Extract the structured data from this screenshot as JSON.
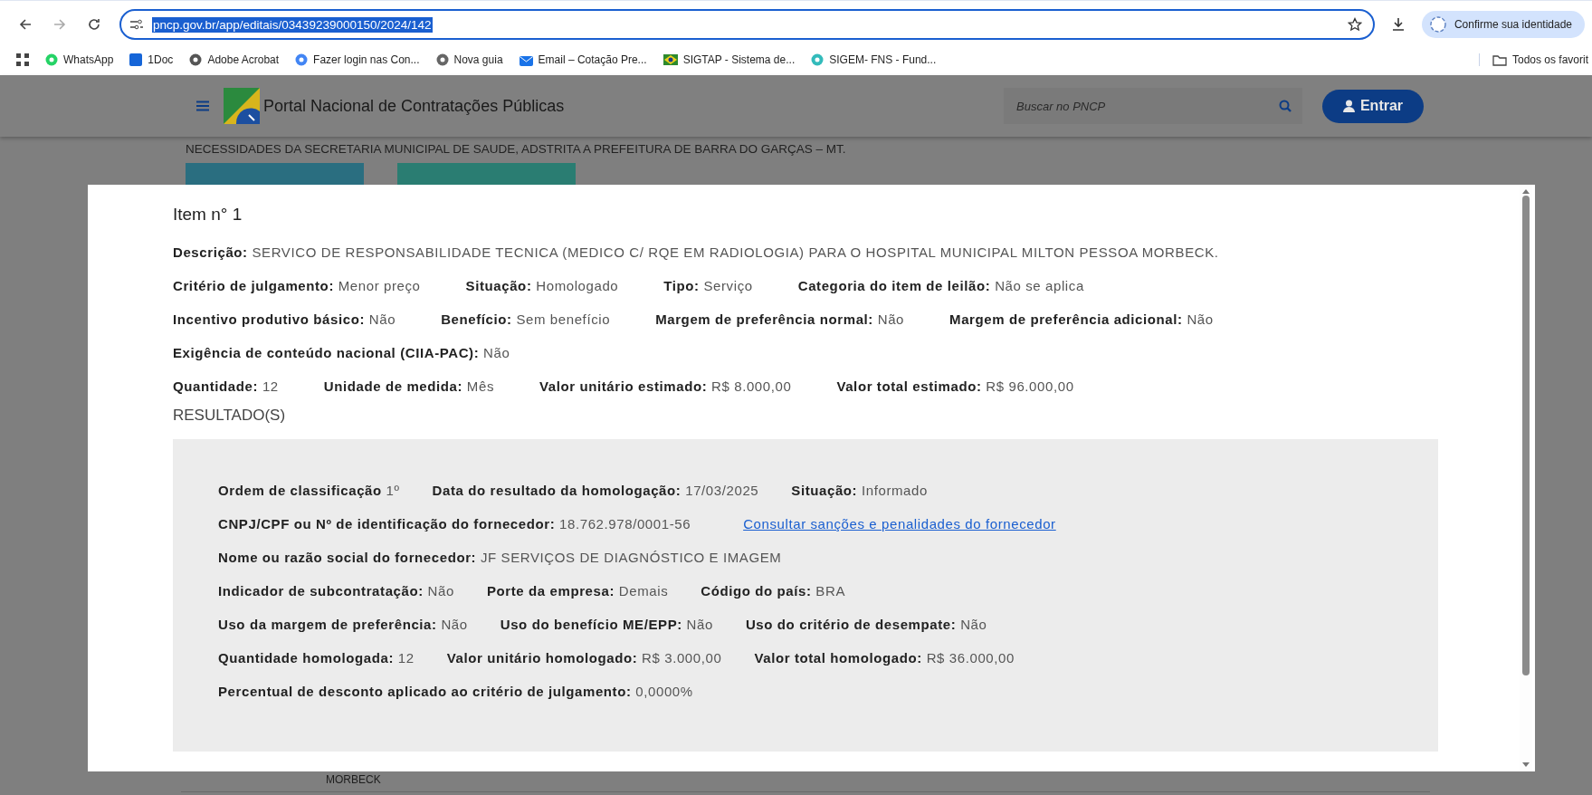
{
  "browser": {
    "address": {
      "text": "pncp.gov.br/app/editais/03439239000150/2024/142",
      "selected": true
    },
    "identity_button": "Confirme sua identidade",
    "bookmarks": [
      {
        "label": "WhatsApp"
      },
      {
        "label": "1Doc"
      },
      {
        "label": "Adobe Acrobat"
      },
      {
        "label": "Fazer login nas Con..."
      },
      {
        "label": "Nova guia"
      },
      {
        "label": "Email – Cotação Pre..."
      },
      {
        "label": "SIGTAP - Sistema de..."
      },
      {
        "label": "SIGEM- FNS - Fund..."
      }
    ],
    "all_bookmarks": "Todos os favorit"
  },
  "page": {
    "header": {
      "title": "Portal Nacional de Contratações Públicas",
      "search_placeholder": "Buscar no PNCP",
      "login_button": "Entrar"
    },
    "object_text": "NECESSIDADES DA SECRETARIA MUNICIPAL DE SAUDE, ADSTRITA A PREFEITURA DE BARRA DO GARÇAS – MT.",
    "below_text": "MORBECK"
  },
  "modal": {
    "title": "Item n° 1",
    "rows": [
      [
        {
          "label": "Descrição:",
          "value": "SERVICO DE RESPONSABILIDADE TECNICA (MEDICO C/ RQE EM RADIOLOGIA) PARA O HOSPITAL MUNICIPAL MILTON PESSOA MORBECK."
        }
      ],
      [
        {
          "label": "Critério de julgamento:",
          "value": "Menor preço"
        },
        {
          "label": "Situação:",
          "value": "Homologado"
        },
        {
          "label": "Tipo:",
          "value": "Serviço"
        },
        {
          "label": "Categoria do item de leilão:",
          "value": "Não se aplica"
        }
      ],
      [
        {
          "label": "Incentivo produtivo básico:",
          "value": "Não"
        },
        {
          "label": "Benefício:",
          "value": "Sem benefício"
        },
        {
          "label": "Margem de preferência normal:",
          "value": "Não"
        },
        {
          "label": "Margem de preferência adicional:",
          "value": "Não"
        }
      ],
      [
        {
          "label": "Exigência de conteúdo nacional (CIIA-PAC):",
          "value": "Não"
        }
      ],
      [
        {
          "label": "Quantidade:",
          "value": "12"
        },
        {
          "label": "Unidade de medida:",
          "value": "Mês"
        },
        {
          "label": "Valor unitário estimado:",
          "value": "R$ 8.000,00"
        },
        {
          "label": "Valor total estimado:",
          "value": "R$ 96.000,00"
        }
      ]
    ],
    "results_heading": "RESULTADO(S)",
    "result_rows": [
      [
        {
          "kind": "field",
          "label": "Ordem de classificação",
          "value": "1º"
        },
        {
          "kind": "field",
          "label": "Data do resultado da homologação:",
          "value": "17/03/2025"
        },
        {
          "kind": "field",
          "label": "Situação:",
          "value": "Informado"
        }
      ],
      [
        {
          "kind": "field",
          "label": "CNPJ/CPF ou Nº de identificação do fornecedor:",
          "value": "18.762.978/0001-56"
        },
        {
          "kind": "link",
          "value": "Consultar sanções e penalidades do fornecedor"
        }
      ],
      [
        {
          "kind": "field",
          "label": "Nome ou razão social do fornecedor:",
          "value": "JF SERVIÇOS DE DIAGNÓSTICO E IMAGEM"
        }
      ],
      [
        {
          "kind": "field",
          "label": "Indicador de subcontratação:",
          "value": "Não"
        },
        {
          "kind": "field",
          "label": "Porte da empresa:",
          "value": "Demais"
        },
        {
          "kind": "field",
          "label": "Código do país:",
          "value": "BRA"
        }
      ],
      [
        {
          "kind": "field",
          "label": "Uso da margem de preferência:",
          "value": "Não"
        },
        {
          "kind": "field",
          "label": "Uso do benefício ME/EPP:",
          "value": "Não"
        },
        {
          "kind": "field",
          "label": "Uso do critério de desempate:",
          "value": "Não"
        }
      ],
      [
        {
          "kind": "field",
          "label": "Quantidade homologada:",
          "value": "12"
        },
        {
          "kind": "field",
          "label": "Valor unitário homologado:",
          "value": "R$ 3.000,00"
        },
        {
          "kind": "field",
          "label": "Valor total homologado:",
          "value": "R$ 36.000,00"
        }
      ],
      [
        {
          "kind": "field",
          "label": "Percentual de desconto aplicado ao critério de julgamento:",
          "value": "0,0000%"
        }
      ]
    ]
  }
}
